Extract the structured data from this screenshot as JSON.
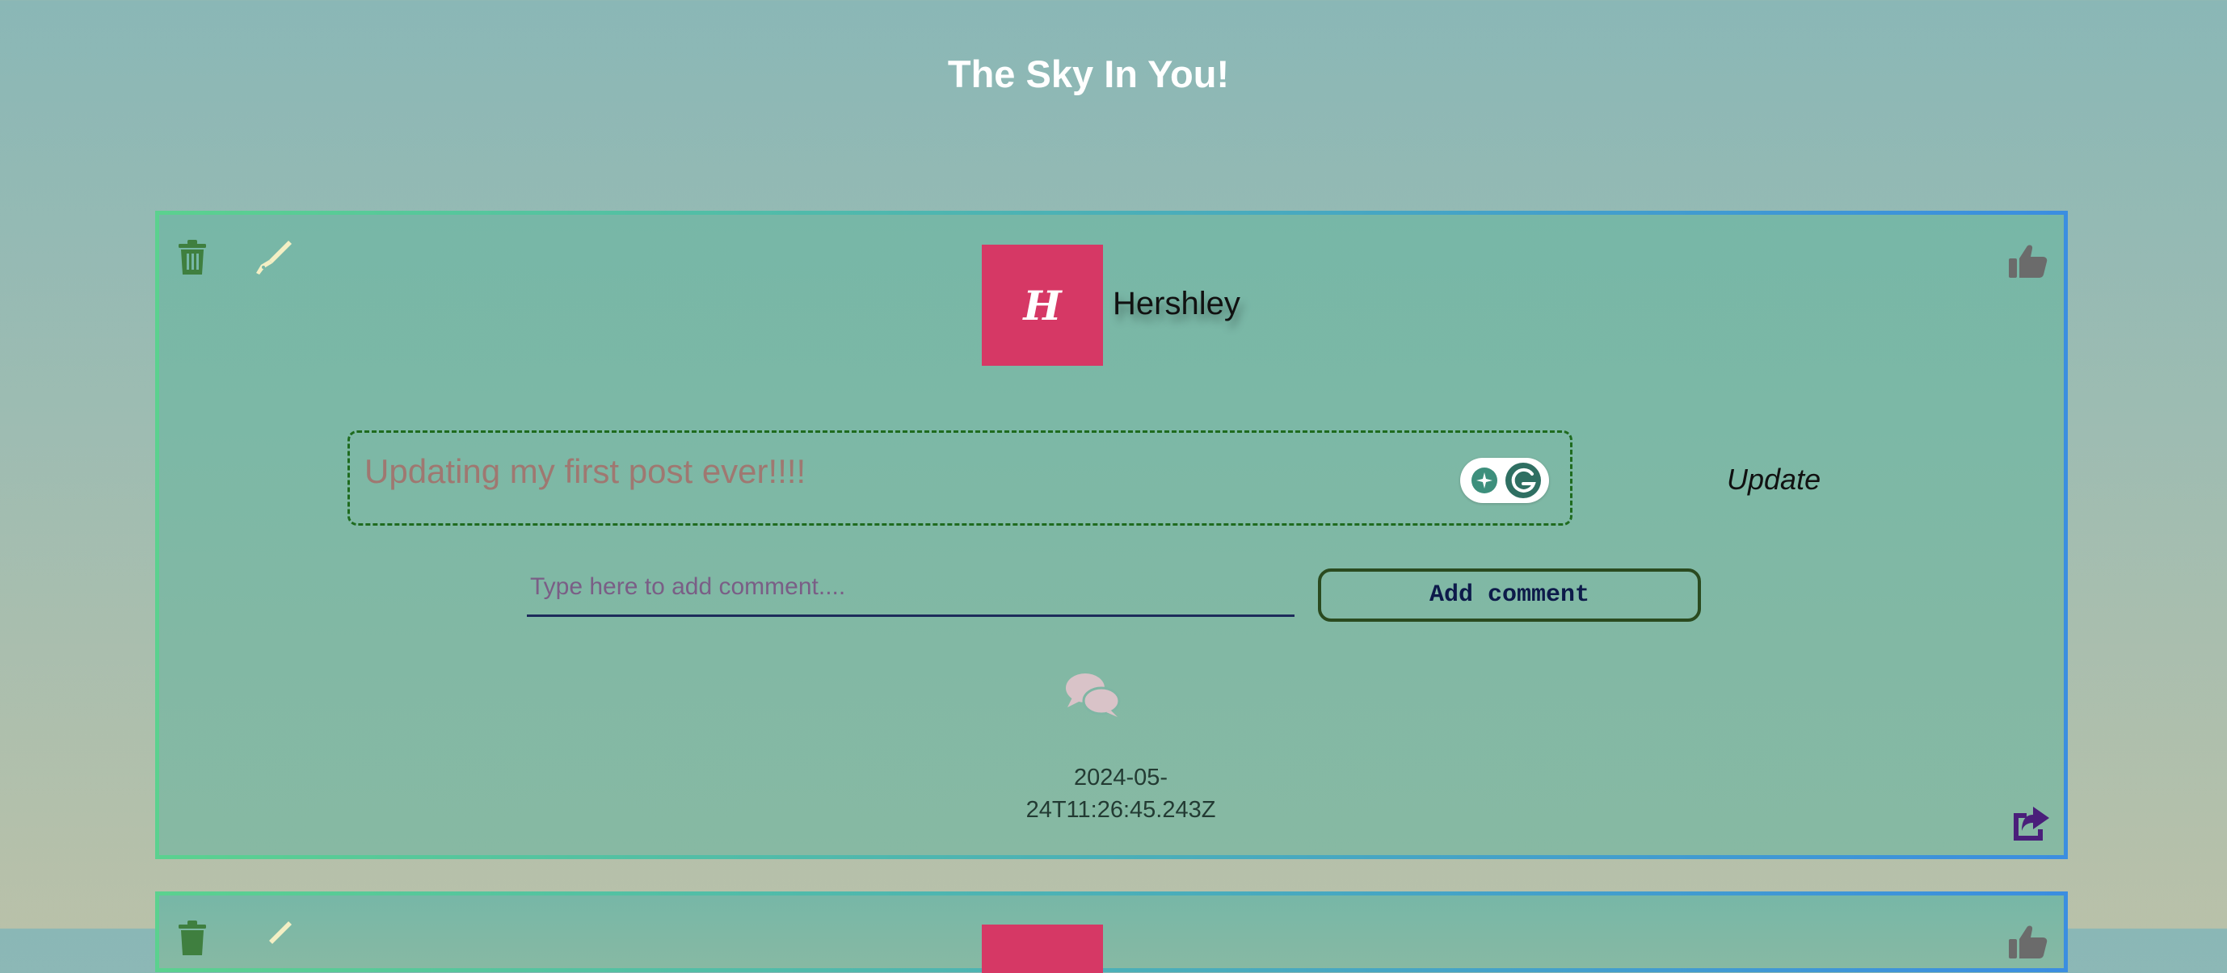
{
  "page": {
    "title": "The Sky In You!"
  },
  "posts": [
    {
      "avatar_initial": "H",
      "author": "Hershley",
      "content": "Updating my first post ever!!!!",
      "update_label": "Update",
      "comment_placeholder": "Type here to add comment....",
      "add_comment_label": "Add comment",
      "timestamp_line1": "2024-05-",
      "timestamp_line2": "24T11:26:45.243Z"
    }
  ],
  "icons": {
    "delete": "trash-icon",
    "edit": "pen-icon",
    "like": "thumbs-up-icon",
    "comments": "comments-icon",
    "share": "share-icon",
    "grammarly": "grammarly-icon"
  },
  "colors": {
    "avatar_bg": "#d63865",
    "trash": "#3f7f3f",
    "pen": "#f4efc4",
    "thumb": "#6b6b6b",
    "comments": "#d9c3c8",
    "share": "#4a1f7a",
    "card_border_start": "#5bd18f",
    "card_border_end": "#3b8ee0"
  }
}
